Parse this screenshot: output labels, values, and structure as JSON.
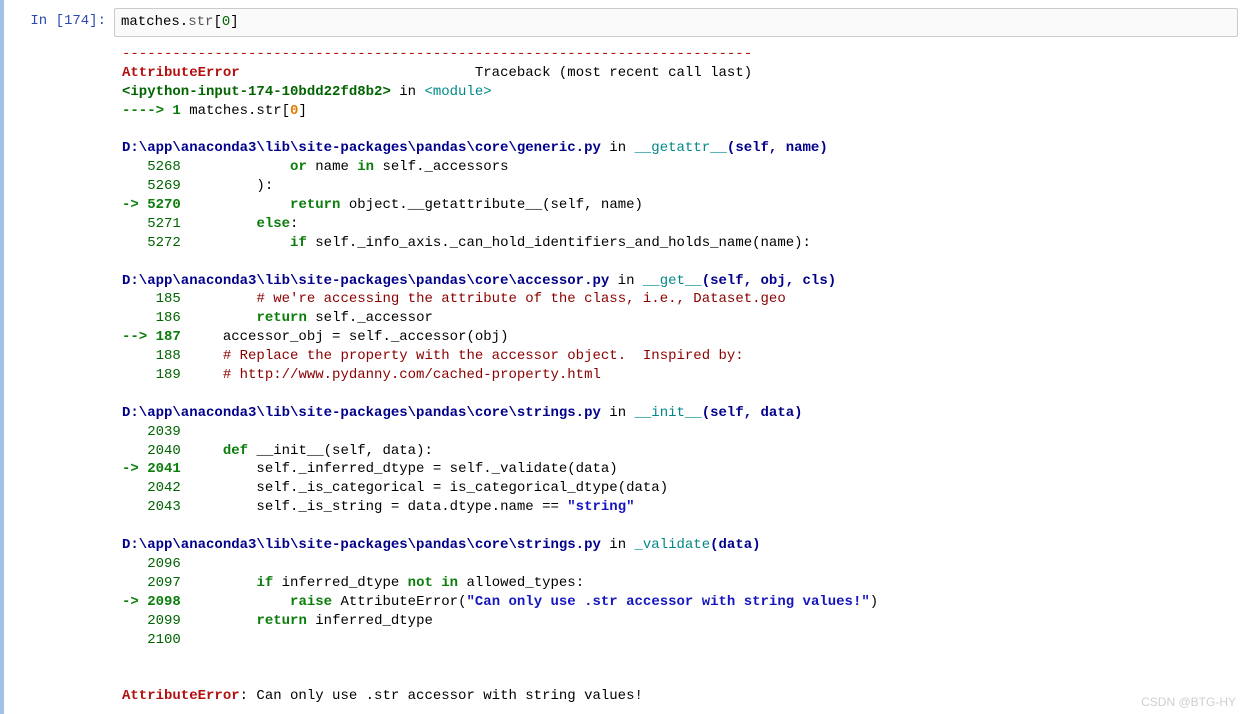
{
  "prompt": {
    "in_label": "In  [174]:"
  },
  "input": "matches.str[0]",
  "hr": "---------------------------------------------------------------------------",
  "header": {
    "err_name": "AttributeError",
    "traceback": "Traceback (most recent call last)",
    "loc_prefix": "<ipython-input-174-10bdd22fd8b2>",
    "in_kw": " in ",
    "module": "<module>",
    "arrow": "----> 1",
    "code_prefix": " matches.str[",
    "code_idx": "0",
    "code_suffix": "]"
  },
  "frames": [
    {
      "path": "D:\\app\\anaconda3\\lib\\site-packages\\pandas\\core\\generic.py",
      "in_kw": " in ",
      "func": "__getattr__",
      "sig": "(self, name)",
      "lines": [
        {
          "ln": "   5268",
          "arrow": "",
          "segs": [
            {
              "t": "            ",
              "c": ""
            },
            {
              "t": "or",
              "c": "green bold"
            },
            {
              "t": " name ",
              "c": ""
            },
            {
              "t": "in",
              "c": "green bold"
            },
            {
              "t": " self._accessors",
              "c": ""
            }
          ]
        },
        {
          "ln": "   5269",
          "arrow": "",
          "segs": [
            {
              "t": "        ):",
              "c": ""
            }
          ]
        },
        {
          "ln": "-> 5270",
          "arrow": "y",
          "segs": [
            {
              "t": "            ",
              "c": ""
            },
            {
              "t": "return",
              "c": "green bold"
            },
            {
              "t": " object.__getattribute__(self, name)",
              "c": ""
            }
          ]
        },
        {
          "ln": "   5271",
          "arrow": "",
          "segs": [
            {
              "t": "        ",
              "c": ""
            },
            {
              "t": "else",
              "c": "green bold"
            },
            {
              "t": ":",
              "c": ""
            }
          ]
        },
        {
          "ln": "   5272",
          "arrow": "",
          "segs": [
            {
              "t": "            ",
              "c": ""
            },
            {
              "t": "if",
              "c": "green bold"
            },
            {
              "t": " self._info_axis._can_hold_identifiers_and_holds_name(name):",
              "c": ""
            }
          ]
        }
      ]
    },
    {
      "path": "D:\\app\\anaconda3\\lib\\site-packages\\pandas\\core\\accessor.py",
      "in_kw": " in ",
      "func": "__get__",
      "sig": "(self, obj, cls)",
      "lines": [
        {
          "ln": "    185",
          "arrow": "",
          "segs": [
            {
              "t": "        ",
              "c": ""
            },
            {
              "t": "# we're accessing the attribute of the class, i.e., Dataset.geo",
              "c": "darkred"
            }
          ]
        },
        {
          "ln": "    186",
          "arrow": "",
          "segs": [
            {
              "t": "        ",
              "c": ""
            },
            {
              "t": "return",
              "c": "green bold"
            },
            {
              "t": " self._accessor",
              "c": ""
            }
          ]
        },
        {
          "ln": "--> 187",
          "arrow": "y",
          "segs": [
            {
              "t": "    accessor_obj = self._accessor(obj)",
              "c": ""
            }
          ]
        },
        {
          "ln": "    188",
          "arrow": "",
          "segs": [
            {
              "t": "    ",
              "c": ""
            },
            {
              "t": "# Replace the property with the accessor object.  Inspired by:",
              "c": "darkred"
            }
          ]
        },
        {
          "ln": "    189",
          "arrow": "",
          "segs": [
            {
              "t": "    ",
              "c": ""
            },
            {
              "t": "# http://www.pydanny.com/cached-property.html",
              "c": "darkred"
            }
          ]
        }
      ]
    },
    {
      "path": "D:\\app\\anaconda3\\lib\\site-packages\\pandas\\core\\strings.py",
      "in_kw": " in ",
      "func": "__init__",
      "sig": "(self, data)",
      "lines": [
        {
          "ln": "   2039",
          "arrow": "",
          "segs": [
            {
              "t": "",
              "c": ""
            }
          ]
        },
        {
          "ln": "   2040",
          "arrow": "",
          "segs": [
            {
              "t": "    ",
              "c": ""
            },
            {
              "t": "def",
              "c": "green bold"
            },
            {
              "t": " __init__(self, data):",
              "c": ""
            }
          ]
        },
        {
          "ln": "-> 2041",
          "arrow": "y",
          "segs": [
            {
              "t": "        self._inferred_dtype = self._validate(data)",
              "c": ""
            }
          ]
        },
        {
          "ln": "   2042",
          "arrow": "",
          "segs": [
            {
              "t": "        self._is_categorical = is_categorical_dtype(data)",
              "c": ""
            }
          ]
        },
        {
          "ln": "   2043",
          "arrow": "",
          "segs": [
            {
              "t": "        self._is_string = data.dtype.name == ",
              "c": ""
            },
            {
              "t": "\"string\"",
              "c": "blue bold"
            }
          ]
        }
      ]
    },
    {
      "path": "D:\\app\\anaconda3\\lib\\site-packages\\pandas\\core\\strings.py",
      "in_kw": " in ",
      "func": "_validate",
      "sig": "(data)",
      "lines": [
        {
          "ln": "   2096",
          "arrow": "",
          "segs": [
            {
              "t": "",
              "c": ""
            }
          ]
        },
        {
          "ln": "   2097",
          "arrow": "",
          "segs": [
            {
              "t": "        ",
              "c": ""
            },
            {
              "t": "if",
              "c": "green bold"
            },
            {
              "t": " inferred_dtype ",
              "c": ""
            },
            {
              "t": "not in",
              "c": "green bold"
            },
            {
              "t": " allowed_types:",
              "c": ""
            }
          ]
        },
        {
          "ln": "-> 2098",
          "arrow": "y",
          "segs": [
            {
              "t": "            ",
              "c": ""
            },
            {
              "t": "raise",
              "c": "green bold"
            },
            {
              "t": " AttributeError(",
              "c": ""
            },
            {
              "t": "\"Can only use .str accessor with string values!\"",
              "c": "blue bold"
            },
            {
              "t": ")",
              "c": ""
            }
          ]
        },
        {
          "ln": "   2099",
          "arrow": "",
          "segs": [
            {
              "t": "        ",
              "c": ""
            },
            {
              "t": "return",
              "c": "green bold"
            },
            {
              "t": " inferred_dtype",
              "c": ""
            }
          ]
        },
        {
          "ln": "   2100",
          "arrow": "",
          "segs": [
            {
              "t": "",
              "c": ""
            }
          ]
        }
      ]
    }
  ],
  "final": {
    "err": "AttributeError",
    "msg": ": Can only use .str accessor with string values!"
  },
  "watermark": "CSDN @BTG-HY"
}
